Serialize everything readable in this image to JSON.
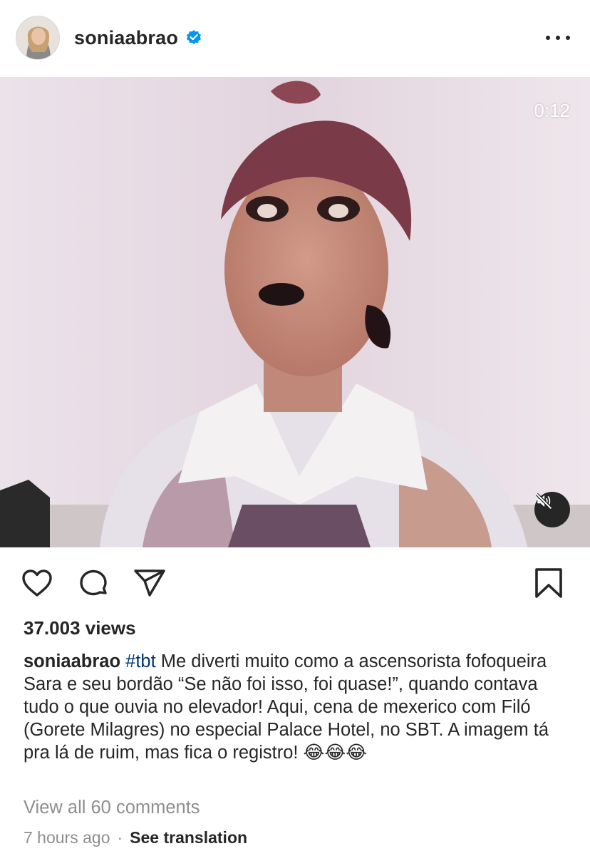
{
  "post": {
    "username": "soniaabrao",
    "verified_icon": "verified-badge-icon",
    "more_icon": "more-options-icon",
    "video_timer": "0:12",
    "mute_icon": "muted-speaker-icon"
  },
  "actions": {
    "like_icon": "heart-icon",
    "comment_icon": "comment-bubble-icon",
    "share_icon": "paper-plane-icon",
    "save_icon": "bookmark-icon"
  },
  "stats": {
    "views": "37.003 views"
  },
  "caption": {
    "username": "soniaabrao",
    "hashtag": "#tbt",
    "text": "Me diverti muito como a ascensorista fofoqueira Sara e seu bordão “Se não foi isso, foi quase!”, quando contava tudo o que ouvia no elevador! Aqui, cena de mexerico com Filó (Gorete Milagres) no especial Palace Hotel, no SBT. A imagem tá pra lá de ruim, mas fica o registro! 😂😂😂"
  },
  "footer": {
    "view_comments": "View all 60 comments",
    "time_ago": "7 hours ago",
    "separator": "·",
    "see_translation": "See translation"
  },
  "colors": {
    "text": "#262626",
    "muted": "#8e8e8e",
    "link": "#00376b",
    "verified": "#0095f6"
  }
}
